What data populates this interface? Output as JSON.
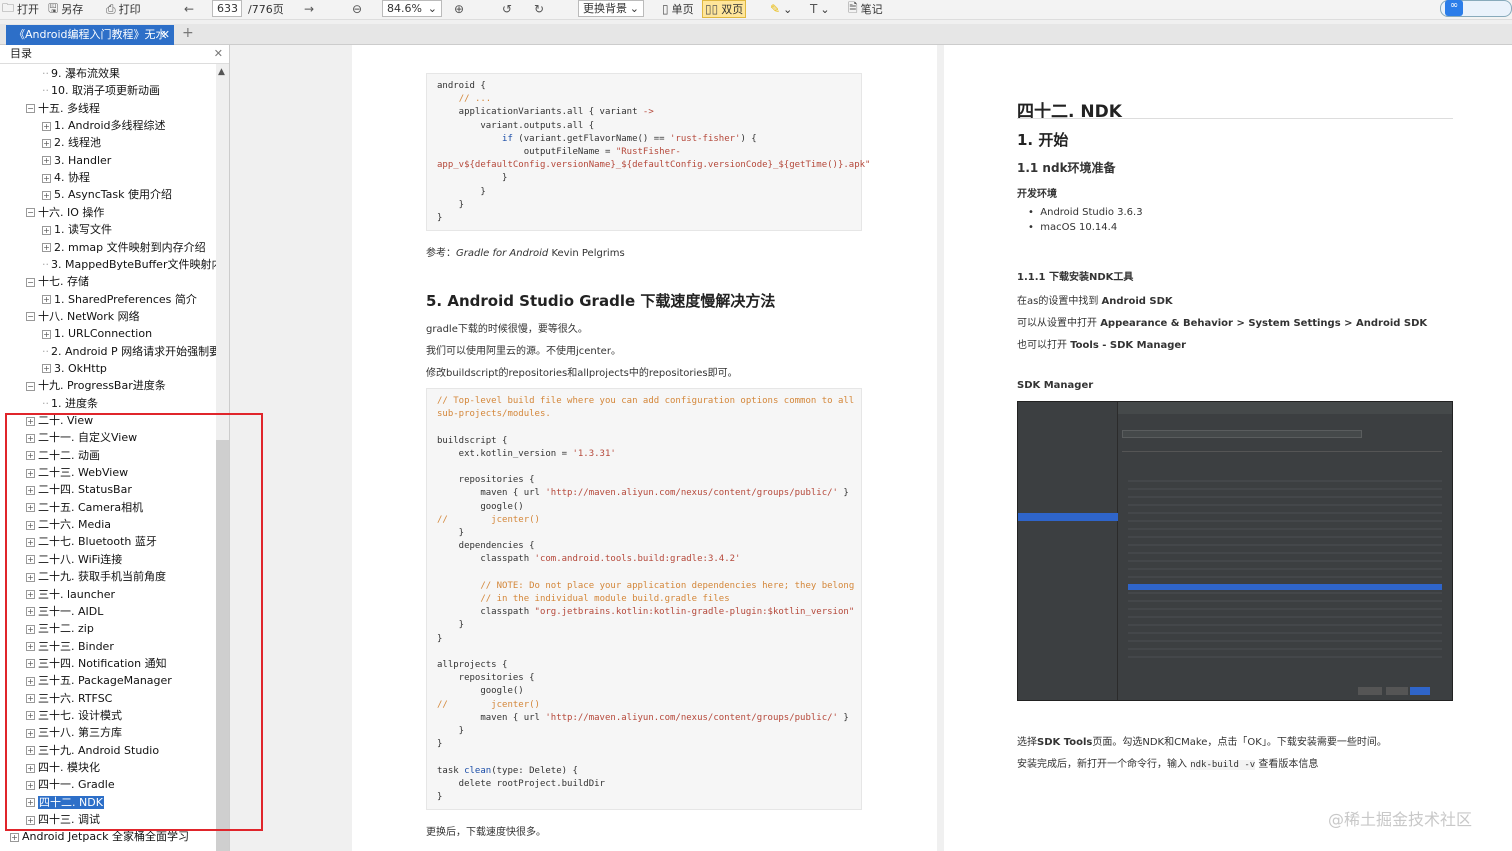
{
  "toolbar": {
    "open": "打开",
    "save_as": "另存",
    "print": "打印",
    "page_current": "633",
    "page_total": "/776页",
    "zoom": "84.6%",
    "background": "更换背景",
    "single_page": "单页",
    "double_page": "双页",
    "notes": "笔记"
  },
  "tab": {
    "title": "《Android编程入门教程》无水"
  },
  "sidebar": {
    "heading": "目录",
    "items": [
      {
        "label": "9. 瀑布流效果"
      },
      {
        "label": "10. 取消子项更新动画"
      },
      {
        "label": "十五. 多线程"
      },
      {
        "label": "1. Android多线程综述"
      },
      {
        "label": "2. 线程池"
      },
      {
        "label": "3. Handler"
      },
      {
        "label": "4. 协程"
      },
      {
        "label": "5. AsyncTask 使用介绍"
      },
      {
        "label": "十六. IO 操作"
      },
      {
        "label": "1. 读写文件"
      },
      {
        "label": "2. mmap 文件映射到内存介绍"
      },
      {
        "label": "3. MappedByteBuffer文件映射内"
      },
      {
        "label": "十七. 存储"
      },
      {
        "label": "1. SharedPreferences 简介"
      },
      {
        "label": "十八. NetWork 网络"
      },
      {
        "label": "1. URLConnection"
      },
      {
        "label": "2. Android P 网络请求开始强制要"
      },
      {
        "label": "3. OkHttp"
      },
      {
        "label": "十九. ProgressBar进度条"
      },
      {
        "label": "1. 进度条"
      },
      {
        "label": "二十. View"
      },
      {
        "label": "二十一. 自定义View"
      },
      {
        "label": "二十二. 动画"
      },
      {
        "label": "二十三. WebView"
      },
      {
        "label": "二十四. StatusBar"
      },
      {
        "label": "二十五. Camera相机"
      },
      {
        "label": "二十六. Media"
      },
      {
        "label": "二十七. Bluetooth 蓝牙"
      },
      {
        "label": "二十八. WiFi连接"
      },
      {
        "label": "二十九. 获取手机当前角度"
      },
      {
        "label": "三十. launcher"
      },
      {
        "label": "三十一. AIDL"
      },
      {
        "label": "三十二. zip"
      },
      {
        "label": "三十三. Binder"
      },
      {
        "label": "三十四. Notification 通知"
      },
      {
        "label": "三十五. PackageManager"
      },
      {
        "label": "三十六. RTFSC"
      },
      {
        "label": "三十七. 设计模式"
      },
      {
        "label": "三十八. 第三方库"
      },
      {
        "label": "三十九. Android Studio"
      },
      {
        "label": "四十. 模块化"
      },
      {
        "label": "四十一. Gradle"
      },
      {
        "label": "四十二. NDK"
      },
      {
        "label": "四十三. 调试"
      },
      {
        "label": "Android Jetpack 全家桶全面学习"
      }
    ]
  },
  "left_page": {
    "ref_prefix": "参考：",
    "ref_title": "Gradle for Android",
    "ref_author": " Kevin Pelgrims",
    "heading": "5. Android Studio Gradle 下载速度慢解决方法",
    "p1": "gradle下载的时候很慢，要等很久。",
    "p2": "我们可以使用阿里云的源。不使用jcenter。",
    "p3": "修改buildscript的repositories和allprojects中的repositories即可。",
    "p4": "更换后，下载速度快很多。"
  },
  "right_page": {
    "h1": "四十二. NDK",
    "h2": "1. 开始",
    "h3": "1.1 ndk环境准备",
    "env_label": "开发环境",
    "env1": "Android Studio 3.6.3",
    "env2": "macOS 10.14.4",
    "h4": "1.1.1 下载安装NDK工具",
    "s1a": "在as的设置中找到 ",
    "s1b": "Android SDK",
    "s2a": "可以从设置中打开 ",
    "s2b": "Appearance & Behavior > System Settings > Android SDK",
    "s3a": "也可以打开 ",
    "s3b": "Tools - SDK Manager",
    "img_title": "SDK Manager",
    "after1a": "选择",
    "after1b": "SDK Tools",
    "after1c": "页面。勾选NDK和CMake，点击「OK」。下载安装需要一些时间。",
    "after2a": "安装完成后，新打开一个命令行，输入 ",
    "after2b": "ndk-build -v",
    "after2c": " 查看版本信息"
  },
  "watermark": "@稀土掘金技术社区"
}
